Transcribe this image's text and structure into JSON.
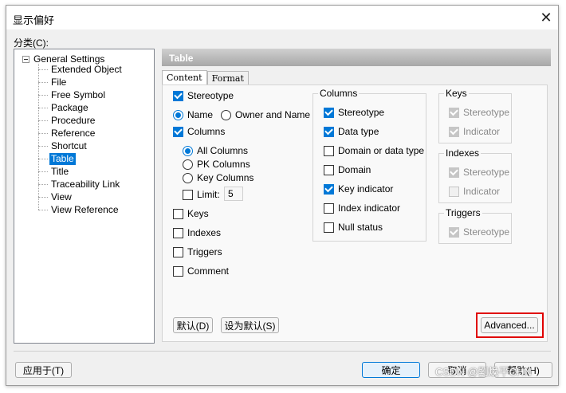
{
  "window": {
    "title": "显示偏好",
    "close_glyph": "✕"
  },
  "category_label": "分类(C):",
  "tree": {
    "root": "General Settings",
    "items": [
      "Extended Object",
      "File",
      "Free Symbol",
      "Package",
      "Procedure",
      "Reference",
      "Shortcut",
      "Table",
      "Title",
      "Traceability Link",
      "View",
      "View Reference"
    ],
    "selected": "Table"
  },
  "panel": {
    "header": "Table",
    "tabs": [
      "Content",
      "Format"
    ],
    "active_tab": "Content"
  },
  "content": {
    "stereotype": "Stereotype",
    "name": "Name",
    "owner_and_name": "Owner and Name",
    "columns": "Columns",
    "all_columns": "All Columns",
    "pk_columns": "PK Columns",
    "key_columns": "Key Columns",
    "limit": "Limit:",
    "limit_value": "5",
    "keys": "Keys",
    "indexes": "Indexes",
    "triggers": "Triggers",
    "comment": "Comment"
  },
  "columns_group": {
    "title": "Columns",
    "stereotype": "Stereotype",
    "data_type": "Data type",
    "domain_or_data_type": "Domain or data type",
    "domain": "Domain",
    "key_indicator": "Key indicator",
    "index_indicator": "Index indicator",
    "null_status": "Null status"
  },
  "keys_group": {
    "title": "Keys",
    "stereotype": "Stereotype",
    "indicator": "Indicator"
  },
  "indexes_group": {
    "title": "Indexes",
    "stereotype": "Stereotype",
    "indicator": "Indicator"
  },
  "triggers_group": {
    "title": "Triggers",
    "stereotype": "Stereotype"
  },
  "buttons": {
    "default": "默认(D)",
    "set_default": "设为默认(S)",
    "advanced": "Advanced...",
    "apply_to": "应用于(T)",
    "ok": "确定",
    "cancel": "取消",
    "help": "帮助(H)"
  },
  "watermark": "CSDN @劉煥平CHN",
  "colors": {
    "accent": "#0078d7",
    "highlight": "#e00000"
  }
}
